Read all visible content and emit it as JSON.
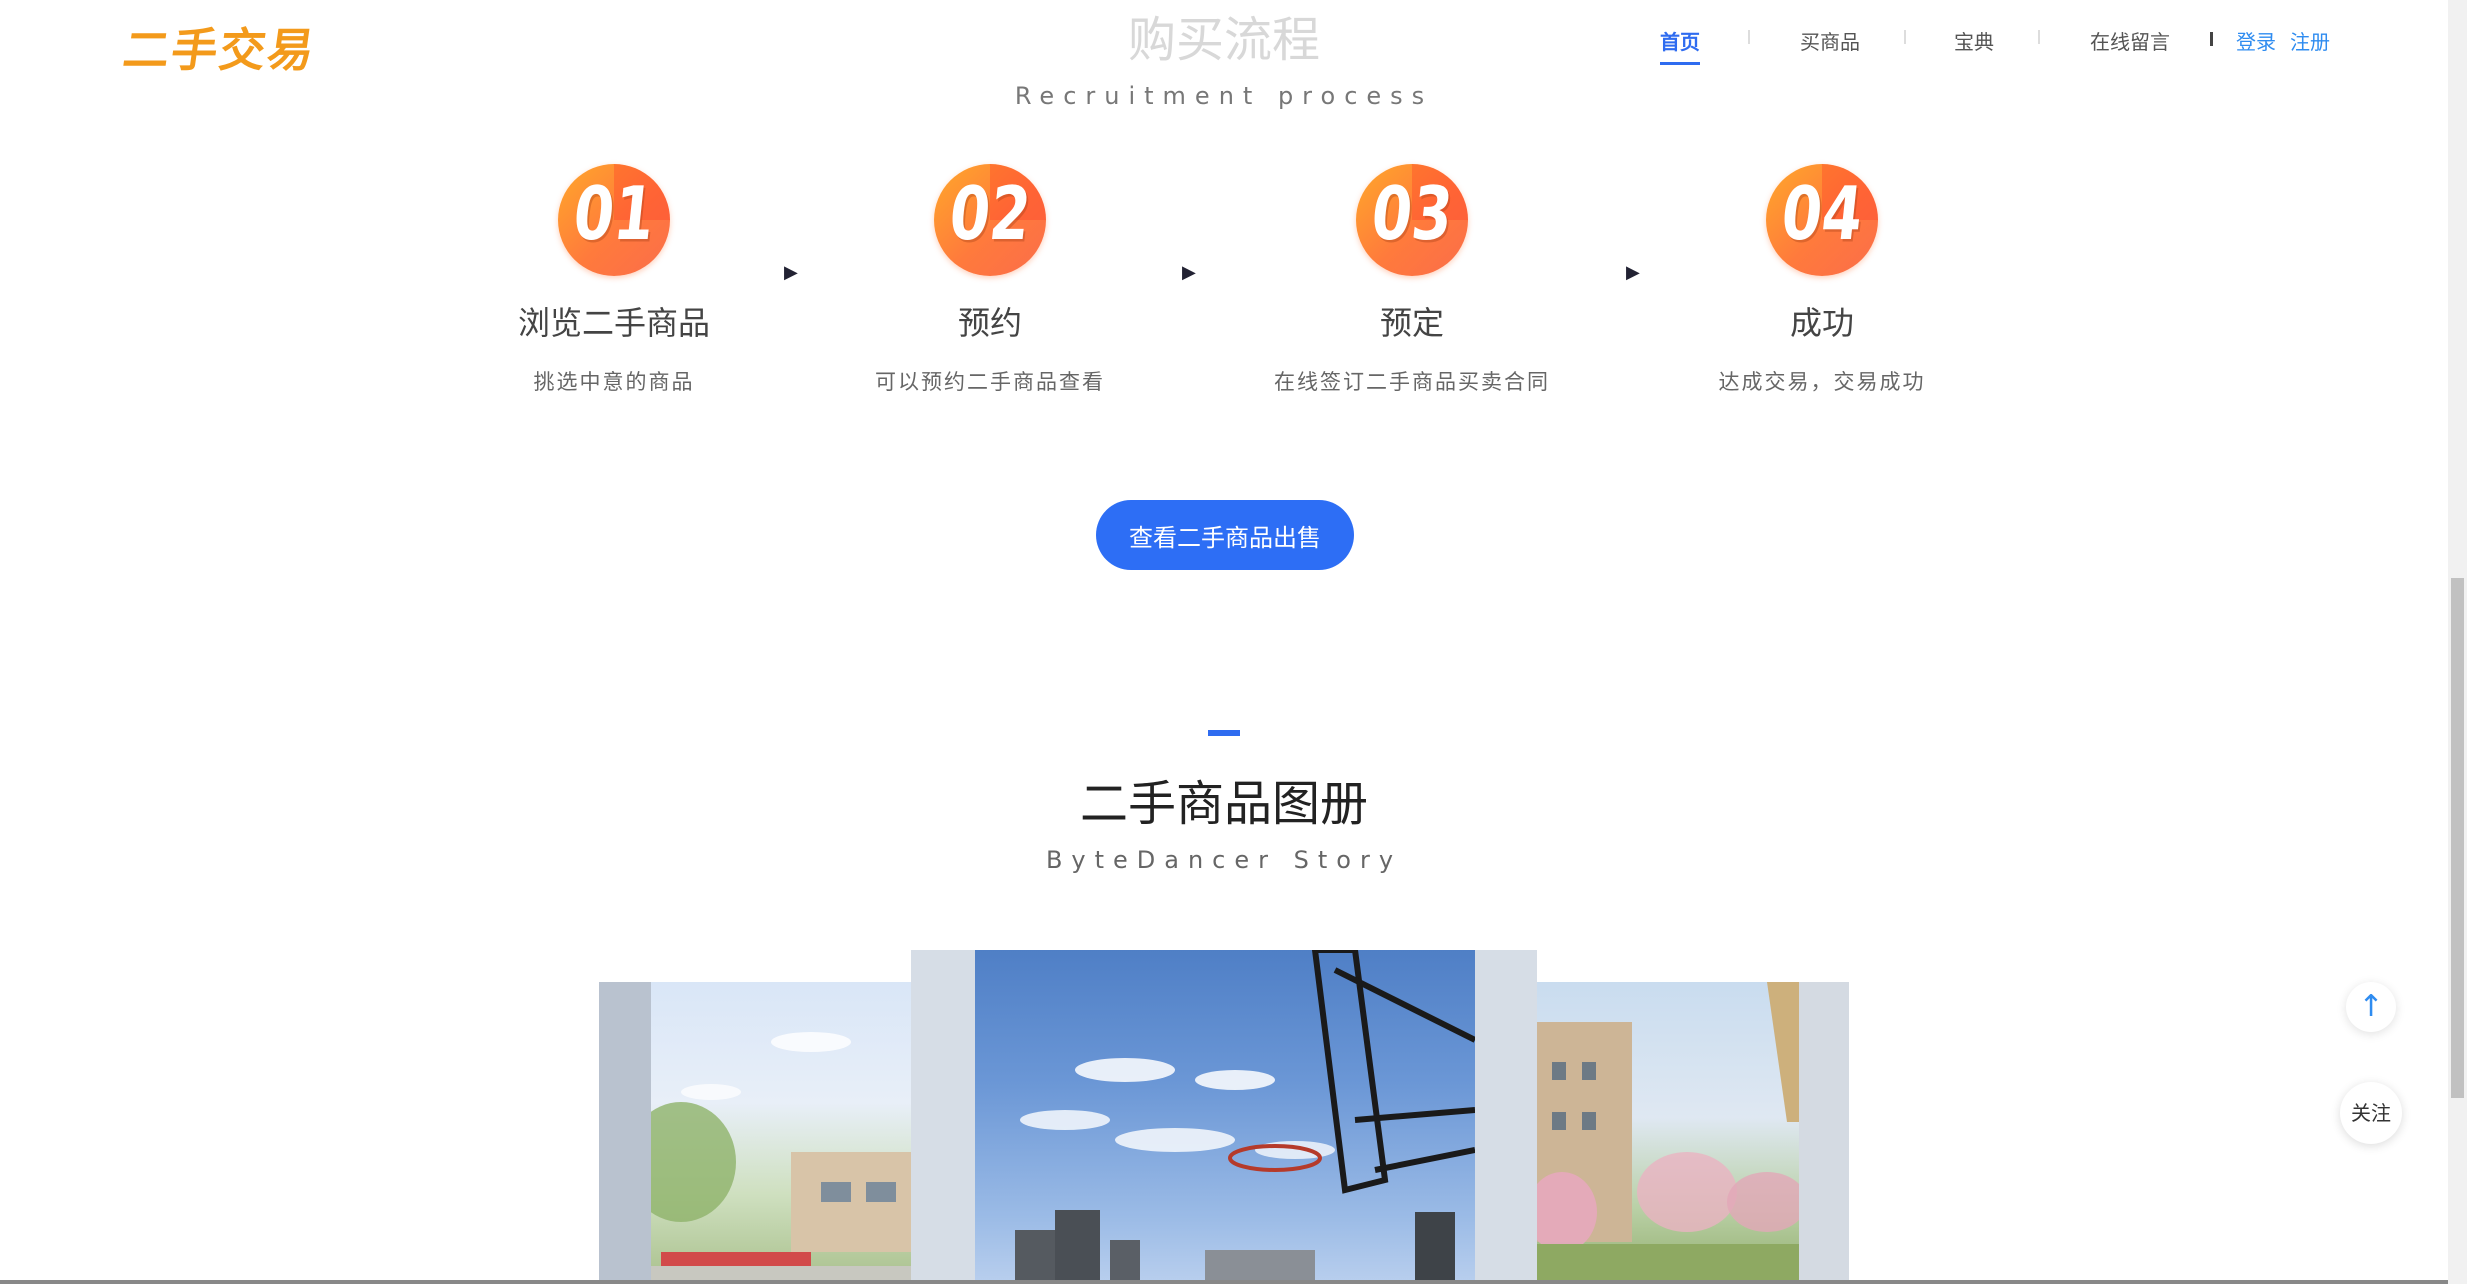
{
  "header": {
    "logo_text": "二手交易",
    "nav": [
      "首页",
      "买商品",
      "宝典",
      "在线留言"
    ],
    "login": "登录",
    "register": "注册"
  },
  "process": {
    "title": "购买流程",
    "subtitle": "Recruitment process",
    "steps": [
      {
        "num": "01",
        "title": "浏览二手商品",
        "desc": "挑选中意的商品"
      },
      {
        "num": "02",
        "title": "预约",
        "desc": "可以预约二手商品查看"
      },
      {
        "num": "03",
        "title": "预定",
        "desc": "在线签订二手商品买卖合同"
      },
      {
        "num": "04",
        "title": "成功",
        "desc": "达成交易，交易成功"
      }
    ],
    "arrow_glyph": "▶",
    "cta_label": "查看二手商品出售"
  },
  "gallery": {
    "title": "二手商品图册",
    "subtitle": "ByteDancer Story"
  },
  "floating": {
    "up_glyph": "↑",
    "follow_label": "关注"
  },
  "colors": {
    "accent": "#2f6cf0",
    "logo": "#f39a1b",
    "badge": "#ff8a34"
  }
}
